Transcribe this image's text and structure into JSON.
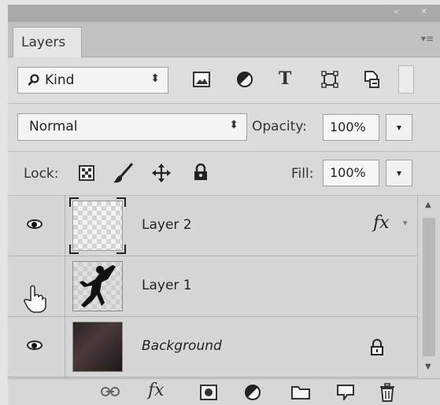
{
  "panel": {
    "tab_label": "Layers",
    "window_controls": [
      "«",
      "✕"
    ],
    "menu_glyph": "▾≡"
  },
  "filter": {
    "kind_label": "Kind",
    "kind_arrow": "⬍",
    "icons": [
      "image-filter-icon",
      "adjustment-filter-icon",
      "type-filter-icon",
      "shape-filter-icon",
      "smart-object-filter-icon"
    ],
    "type_glyph": "T"
  },
  "blend": {
    "mode": "Normal",
    "mode_arrow": "⬍",
    "opacity_label": "Opacity:",
    "opacity_value": "100%",
    "dropdown_glyph": "▾"
  },
  "lock": {
    "label": "Lock:",
    "icons": [
      "lock-transparent-pixels-icon",
      "lock-image-pixels-icon",
      "lock-position-icon",
      "lock-all-icon"
    ],
    "fill_label": "Fill:",
    "fill_value": "100%",
    "dropdown_glyph": "▾"
  },
  "layers": [
    {
      "name": "Layer 2",
      "visible": true,
      "thumb": "transparent",
      "has_fx": true,
      "fx_label": "fx",
      "selected_frame": true
    },
    {
      "name": "Layer 1",
      "visible": false,
      "thumb": "figure"
    },
    {
      "name": "Background",
      "visible": true,
      "thumb": "dark",
      "locked": true
    }
  ],
  "bottom_icons": [
    "link-layers-icon",
    "add-style-icon",
    "add-mask-icon",
    "new-fill-adjustment-icon",
    "new-group-icon",
    "new-layer-icon",
    "delete-layer-icon"
  ],
  "bottom_fx_label": "fx",
  "colors": {
    "panel": "#d8d8d8",
    "tab": "#e6e6e6",
    "accent_text": "#222222"
  }
}
